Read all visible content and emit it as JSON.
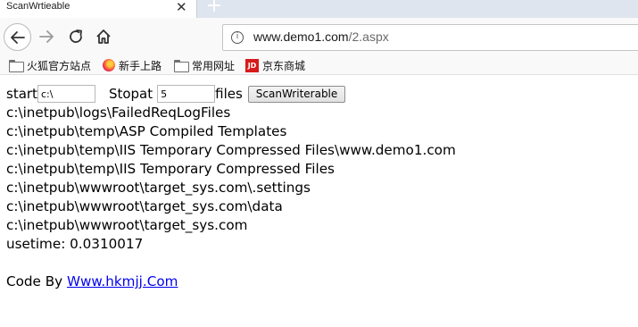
{
  "tab": {
    "title": "ScanWrtieable",
    "close_glyph": "✕",
    "new_tab_glyph": "+"
  },
  "nav": {
    "url_host": "www.demo1.com",
    "url_path": "/2.aspx",
    "icons": [
      "back-arrow-icon",
      "forward-arrow-icon",
      "reload-icon",
      "home-icon",
      "info-icon"
    ]
  },
  "bookmarks": [
    {
      "label": "火狐官方站点",
      "icon": "folder-icon"
    },
    {
      "label": "新手上路",
      "icon": "firefox-icon"
    },
    {
      "label": "常用网址",
      "icon": "folder-icon"
    },
    {
      "label": "京东商城",
      "icon": "jd-icon"
    }
  ],
  "form": {
    "start_label": "start",
    "start_value": "c:\\",
    "stop_label": "Stopat",
    "stop_value": "5",
    "files_label": "files",
    "button_label": "ScanWriterable"
  },
  "results": [
    "c:\\inetpub\\logs\\FailedReqLogFiles",
    "c:\\inetpub\\temp\\ASP Compiled Templates",
    "c:\\inetpub\\temp\\IIS Temporary Compressed Files\\www.demo1.com",
    "c:\\inetpub\\temp\\IIS Temporary Compressed Files",
    "c:\\inetpub\\wwwroot\\target_sys.com\\.settings",
    "c:\\inetpub\\wwwroot\\target_sys.com\\data",
    "c:\\inetpub\\wwwroot\\target_sys.com"
  ],
  "usetime": "usetime: 0.0310017",
  "footer": {
    "prefix": "Code By ",
    "link_text": "Www.hkmjj.Com"
  }
}
